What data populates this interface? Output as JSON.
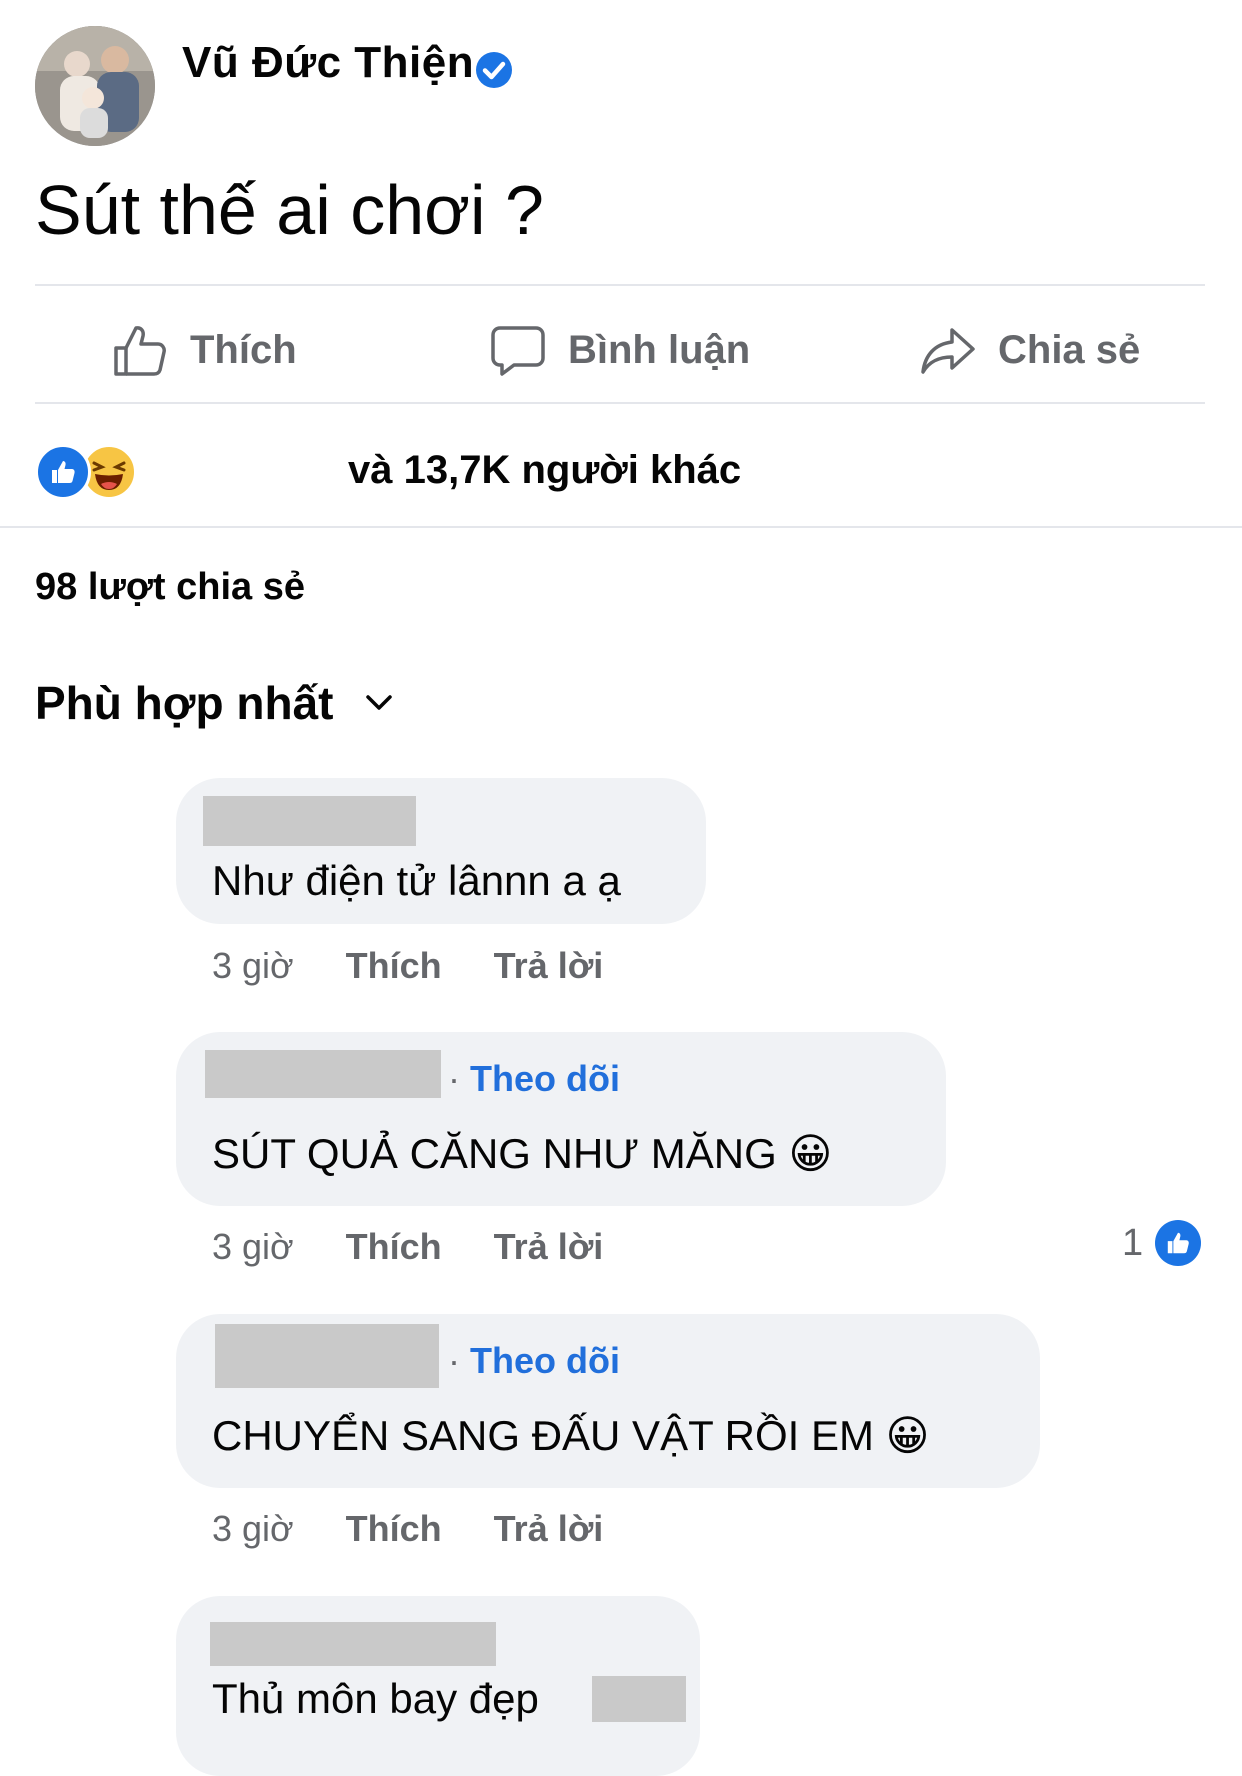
{
  "post": {
    "author": "Vũ Đức Thiện",
    "text": "Sút thế ai chơi ?"
  },
  "actions": {
    "like": "Thích",
    "comment": "Bình luận",
    "share": "Chia sẻ"
  },
  "reactions": {
    "summary": "và 13,7K người khác",
    "icons": [
      "like-icon",
      "haha-icon"
    ]
  },
  "shares_text": "98 lượt chia sẻ",
  "sort_label": "Phù hợp nhất",
  "comments": [
    {
      "text": "Như điện tử lânnn a ạ",
      "time": "3 giờ",
      "like": "Thích",
      "reply": "Trả lời"
    },
    {
      "follow": "Theo dõi",
      "text": "SÚT QUẢ CĂNG NHƯ MĂNG 😀",
      "time": "3 giờ",
      "like": "Thích",
      "reply": "Trả lời",
      "like_count": "1"
    },
    {
      "follow": "Theo dõi",
      "text": "CHUYỂN SANG ĐẤU VẬT RỒI EM 😀",
      "time": "3 giờ",
      "like": "Thích",
      "reply": "Trả lời"
    },
    {
      "text": "Thủ môn bay đẹp"
    }
  ],
  "colors": {
    "accent": "#216fdb",
    "secondary_text": "#65676b",
    "bubble": "#f0f2f5",
    "like_blue": "#1b74e4"
  }
}
